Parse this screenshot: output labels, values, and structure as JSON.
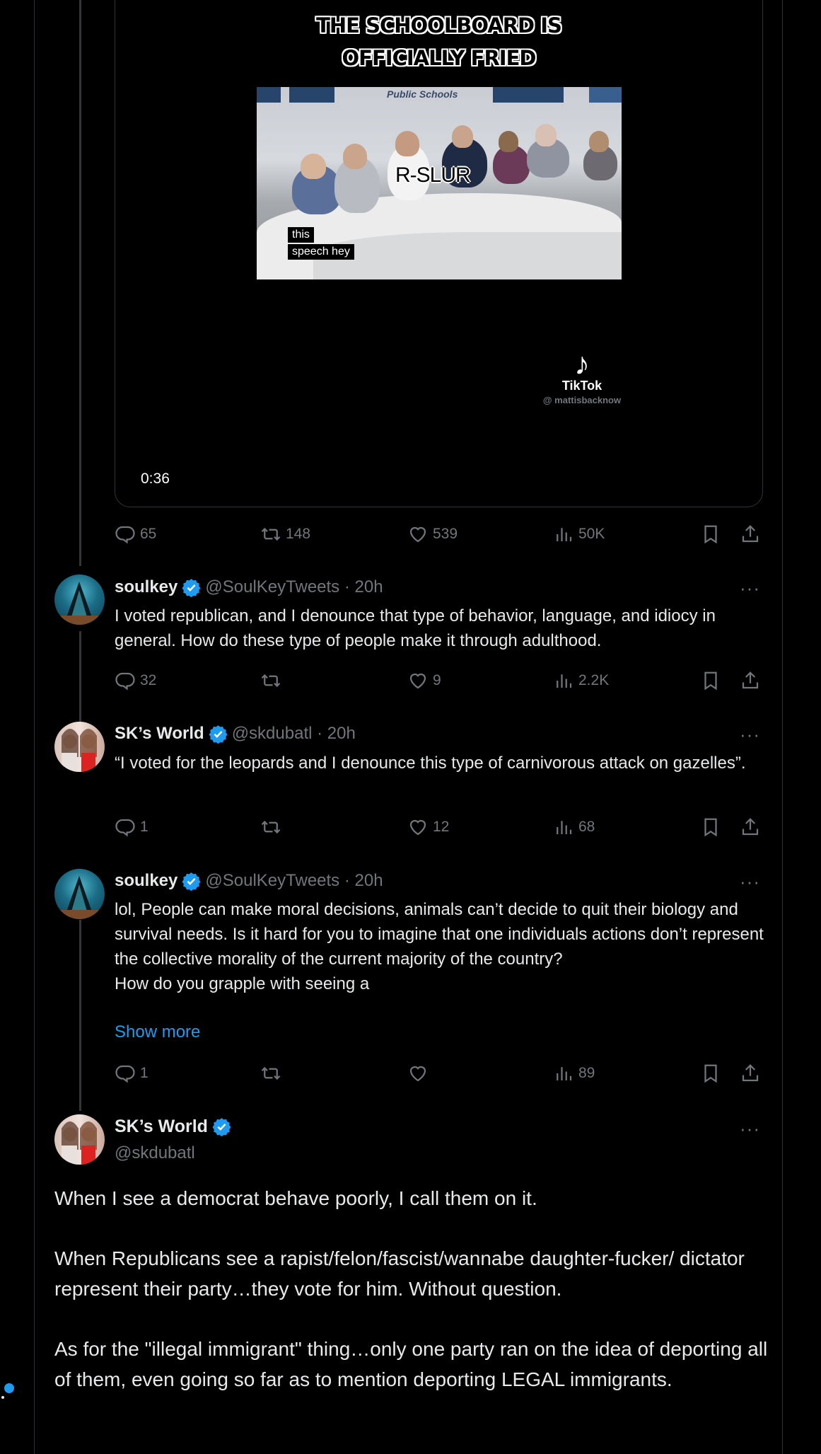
{
  "video": {
    "caption_line1": "THE SCHOOLBOARD IS",
    "caption_line2": "OFFICIALLY FRIED",
    "wall_sign": "Public Schools",
    "overlay_word": "R-SLUR",
    "subtitle_line1": "this",
    "subtitle_line2": "speech hey",
    "watermark_app": "TikTok",
    "watermark_handle": "@ mattisbacknow",
    "duration": "0:36"
  },
  "main_actions": {
    "replies": "65",
    "reposts": "148",
    "likes": "539",
    "views": "50K"
  },
  "replies": [
    {
      "name": "soulkey",
      "handle": "@SoulKeyTweets · 20h",
      "text": "I voted republican, and I denounce that type of behavior, language, and idiocy in general. How do these type of  people make it through adulthood.",
      "replies": "32",
      "reposts": "",
      "likes": "9",
      "views": "2.2K"
    },
    {
      "name": "SK’s World",
      "handle": "@skdubatl · 20h",
      "text": "“I voted for the leopards and I denounce this type of carnivorous attack on gazelles”.",
      "replies": "1",
      "reposts": "",
      "likes": "12",
      "views": "68"
    },
    {
      "name": "soulkey",
      "handle": "@SoulKeyTweets · 20h",
      "text": "lol, People can make moral decisions, animals can’t decide to quit their biology and survival needs. Is it hard for you to imagine that one individuals actions don’t represent the collective morality of the current majority of the country?\nHow do you grapple with seeing a",
      "show_more": "Show more",
      "replies": "1",
      "reposts": "",
      "likes": "",
      "views": "89"
    }
  ],
  "focused": {
    "name": "SK’s World",
    "handle": "@skdubatl",
    "para1": "When I see a democrat behave poorly, I call them on it.",
    "para2": "When Republicans see a rapist/felon/fascist/wannabe daughter-fucker/ dictator represent their party…they vote for him.  Without question.",
    "para3": "As for the \"illegal immigrant\" thing…only one party ran on the idea of deporting all of them, even going so far as to mention deporting LEGAL immigrants."
  },
  "more_label": "···",
  "colors": {
    "accent": "#1d9bf0",
    "muted": "#71767b",
    "text": "#e7e9ea",
    "border": "#2f3336"
  },
  "icons": [
    "reply-icon",
    "repost-icon",
    "like-icon",
    "views-icon",
    "bookmark-icon",
    "share-icon",
    "verified-badge-icon",
    "more-icon",
    "tiktok-logo-icon"
  ]
}
